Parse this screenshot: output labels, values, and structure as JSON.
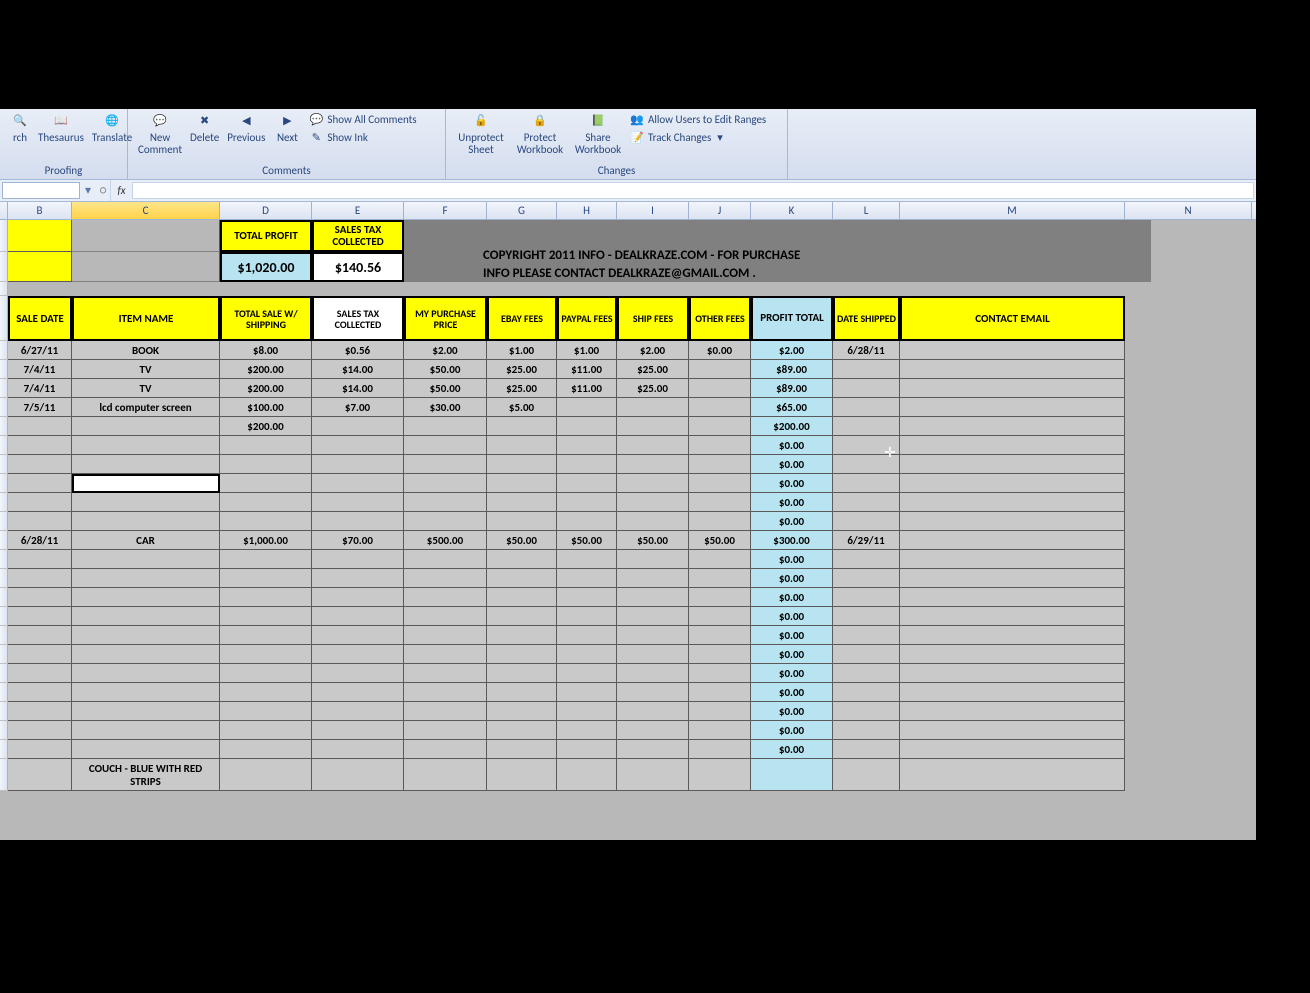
{
  "ribbon": {
    "proofing": {
      "label": "Proofing",
      "research": "rch",
      "thesaurus": "Thesaurus",
      "translate": "Translate"
    },
    "comments": {
      "label": "Comments",
      "new_comment": "New\nComment",
      "delete": "Delete",
      "previous": "Previous",
      "next": "Next",
      "show_all": "Show All Comments",
      "show_ink": "Show Ink"
    },
    "changes": {
      "label": "Changes",
      "unprotect": "Unprotect\nSheet",
      "protect_wb": "Protect\nWorkbook",
      "share_wb": "Share\nWorkbook",
      "allow_users": "Allow Users to Edit Ranges",
      "track_changes": "Track Changes"
    }
  },
  "namebox": {
    "value": "",
    "fx": "fx"
  },
  "columns": [
    "B",
    "C",
    "D",
    "E",
    "F",
    "G",
    "H",
    "I",
    "J",
    "K",
    "L",
    "M",
    "N"
  ],
  "top_cells": {
    "total_profit_label": "TOTAL PROFIT",
    "sales_tax_label": "SALES TAX COLLECTED",
    "total_profit_value": "$1,020.00",
    "sales_tax_value": "$140.56"
  },
  "copyright": "COPYRIGHT 2011 INFO - DEALKRAZE.COM - FOR PURCHASE\nINFO PLEASE CONTACT DEALKRAZE@GMAIL.COM .",
  "headers": {
    "sale_date": "SALE DATE",
    "item_name": "ITEM NAME",
    "total_sale": "TOTAL SALE W/ SHIPPING",
    "sales_tax": "SALES TAX COLLECTED",
    "purchase": "MY PURCHASE PRICE",
    "ebay": "EBAY FEES",
    "paypal": "PAYPAL FEES",
    "ship": "SHIP FEES",
    "other": "OTHER FEES",
    "profit": "PROFIT TOTAL",
    "shipped": "DATE SHIPPED",
    "contact": "CONTACT EMAIL"
  },
  "rows": [
    {
      "date": "6/27/11",
      "item": "BOOK",
      "total": "$8.00",
      "tax": "$0.56",
      "purchase": "$2.00",
      "ebay": "$1.00",
      "paypal": "$1.00",
      "ship": "$2.00",
      "other": "$0.00",
      "profit": "$2.00",
      "shipped": "6/28/11",
      "email": ""
    },
    {
      "date": "7/4/11",
      "item": "TV",
      "total": "$200.00",
      "tax": "$14.00",
      "purchase": "$50.00",
      "ebay": "$25.00",
      "paypal": "$11.00",
      "ship": "$25.00",
      "other": "",
      "profit": "$89.00",
      "shipped": "",
      "email": ""
    },
    {
      "date": "7/4/11",
      "item": "TV",
      "total": "$200.00",
      "tax": "$14.00",
      "purchase": "$50.00",
      "ebay": "$25.00",
      "paypal": "$11.00",
      "ship": "$25.00",
      "other": "",
      "profit": "$89.00",
      "shipped": "",
      "email": ""
    },
    {
      "date": "7/5/11",
      "item": "lcd computer screen",
      "total": "$100.00",
      "tax": "$7.00",
      "purchase": "$30.00",
      "ebay": "$5.00",
      "paypal": "",
      "ship": "",
      "other": "",
      "profit": "$65.00",
      "shipped": "",
      "email": ""
    },
    {
      "date": "",
      "item": "",
      "total": "$200.00",
      "tax": "",
      "purchase": "",
      "ebay": "",
      "paypal": "",
      "ship": "",
      "other": "",
      "profit": "$200.00",
      "shipped": "",
      "email": ""
    },
    {
      "date": "",
      "item": "",
      "total": "",
      "tax": "",
      "purchase": "",
      "ebay": "",
      "paypal": "",
      "ship": "",
      "other": "",
      "profit": "$0.00",
      "shipped": "",
      "email": ""
    },
    {
      "date": "",
      "item": "",
      "total": "",
      "tax": "",
      "purchase": "",
      "ebay": "",
      "paypal": "",
      "ship": "",
      "other": "",
      "profit": "$0.00",
      "shipped": "",
      "email": ""
    },
    {
      "date": "",
      "item": "",
      "total": "",
      "tax": "",
      "purchase": "",
      "ebay": "",
      "paypal": "",
      "ship": "",
      "other": "",
      "profit": "$0.00",
      "shipped": "",
      "email": "",
      "selected": true
    },
    {
      "date": "",
      "item": "",
      "total": "",
      "tax": "",
      "purchase": "",
      "ebay": "",
      "paypal": "",
      "ship": "",
      "other": "",
      "profit": "$0.00",
      "shipped": "",
      "email": ""
    },
    {
      "date": "",
      "item": "",
      "total": "",
      "tax": "",
      "purchase": "",
      "ebay": "",
      "paypal": "",
      "ship": "",
      "other": "",
      "profit": "$0.00",
      "shipped": "",
      "email": ""
    },
    {
      "date": "6/28/11",
      "item": "CAR",
      "total": "$1,000.00",
      "tax": "$70.00",
      "purchase": "$500.00",
      "ebay": "$50.00",
      "paypal": "$50.00",
      "ship": "$50.00",
      "other": "$50.00",
      "profit": "$300.00",
      "shipped": "6/29/11",
      "email": ""
    },
    {
      "date": "",
      "item": "",
      "total": "",
      "tax": "",
      "purchase": "",
      "ebay": "",
      "paypal": "",
      "ship": "",
      "other": "",
      "profit": "$0.00",
      "shipped": "",
      "email": ""
    },
    {
      "date": "",
      "item": "",
      "total": "",
      "tax": "",
      "purchase": "",
      "ebay": "",
      "paypal": "",
      "ship": "",
      "other": "",
      "profit": "$0.00",
      "shipped": "",
      "email": ""
    },
    {
      "date": "",
      "item": "",
      "total": "",
      "tax": "",
      "purchase": "",
      "ebay": "",
      "paypal": "",
      "ship": "",
      "other": "",
      "profit": "$0.00",
      "shipped": "",
      "email": ""
    },
    {
      "date": "",
      "item": "",
      "total": "",
      "tax": "",
      "purchase": "",
      "ebay": "",
      "paypal": "",
      "ship": "",
      "other": "",
      "profit": "$0.00",
      "shipped": "",
      "email": ""
    },
    {
      "date": "",
      "item": "",
      "total": "",
      "tax": "",
      "purchase": "",
      "ebay": "",
      "paypal": "",
      "ship": "",
      "other": "",
      "profit": "$0.00",
      "shipped": "",
      "email": ""
    },
    {
      "date": "",
      "item": "",
      "total": "",
      "tax": "",
      "purchase": "",
      "ebay": "",
      "paypal": "",
      "ship": "",
      "other": "",
      "profit": "$0.00",
      "shipped": "",
      "email": ""
    },
    {
      "date": "",
      "item": "",
      "total": "",
      "tax": "",
      "purchase": "",
      "ebay": "",
      "paypal": "",
      "ship": "",
      "other": "",
      "profit": "$0.00",
      "shipped": "",
      "email": ""
    },
    {
      "date": "",
      "item": "",
      "total": "",
      "tax": "",
      "purchase": "",
      "ebay": "",
      "paypal": "",
      "ship": "",
      "other": "",
      "profit": "$0.00",
      "shipped": "",
      "email": ""
    },
    {
      "date": "",
      "item": "",
      "total": "",
      "tax": "",
      "purchase": "",
      "ebay": "",
      "paypal": "",
      "ship": "",
      "other": "",
      "profit": "$0.00",
      "shipped": "",
      "email": ""
    },
    {
      "date": "",
      "item": "",
      "total": "",
      "tax": "",
      "purchase": "",
      "ebay": "",
      "paypal": "",
      "ship": "",
      "other": "",
      "profit": "$0.00",
      "shipped": "",
      "email": ""
    },
    {
      "date": "",
      "item": "",
      "total": "",
      "tax": "",
      "purchase": "",
      "ebay": "",
      "paypal": "",
      "ship": "",
      "other": "",
      "profit": "$0.00",
      "shipped": "",
      "email": ""
    },
    {
      "date": "",
      "item": "COUCH - BLUE WITH RED STRIPS",
      "total": "",
      "tax": "",
      "purchase": "",
      "ebay": "",
      "paypal": "",
      "ship": "",
      "other": "",
      "profit": "",
      "shipped": "",
      "email": "",
      "tall": true
    }
  ]
}
